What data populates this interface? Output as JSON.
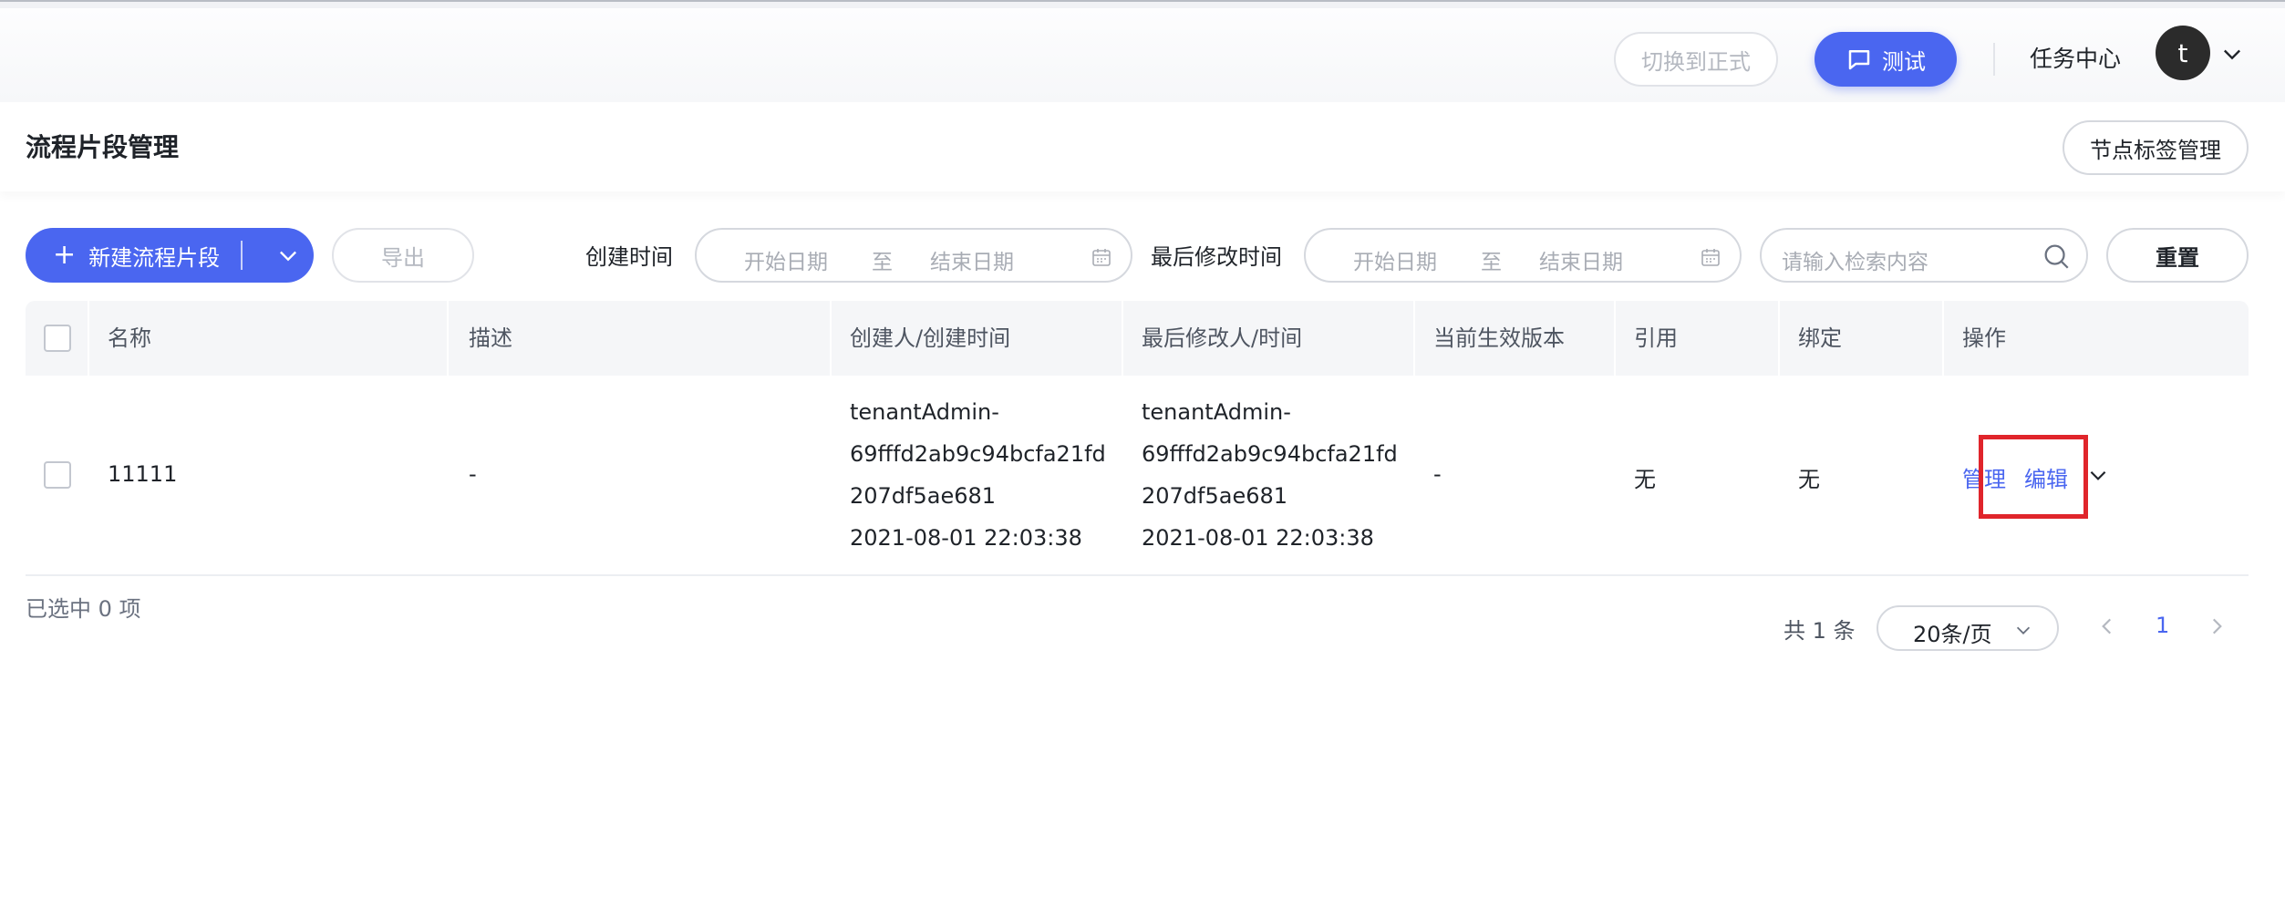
{
  "header": {
    "switch_formal_label": "切换到正式",
    "test_label": "测试",
    "task_center_label": "任务中心",
    "avatar_initial": "t"
  },
  "page": {
    "title": "流程片段管理",
    "tag_manage_label": "节点标签管理"
  },
  "toolbar": {
    "new_label": "新建流程片段",
    "export_label": "导出",
    "create_time_label": "创建时间",
    "modify_time_label": "最后修改时间",
    "start_placeholder": "开始日期",
    "to_label": "至",
    "end_placeholder": "结束日期",
    "search_placeholder": "请输入检索内容",
    "reset_label": "重置"
  },
  "table": {
    "columns": [
      "名称",
      "描述",
      "创建人/创建时间",
      "最后修改人/时间",
      "当前生效版本",
      "引用",
      "绑定",
      "操作"
    ],
    "rows": [
      {
        "name": "11111",
        "description": "-",
        "creator_line1": "tenantAdmin-",
        "creator_line2": "69fffd2ab9c94bcfa21fd",
        "creator_line3": "207df5ae681",
        "create_time": "2021-08-01 22:03:38",
        "modifier_line1": "tenantAdmin-",
        "modifier_line2": "69fffd2ab9c94bcfa21fd",
        "modifier_line3": "207df5ae681",
        "modify_time": "2021-08-01 22:03:38",
        "version": "-",
        "reference": "无",
        "binding": "无",
        "op_manage": "管理",
        "op_edit": "编辑"
      }
    ]
  },
  "footer": {
    "selected_text": "已选中 0 项",
    "total_text": "共 1 条",
    "page_size": "20条/页",
    "current_page": "1"
  },
  "colors": {
    "primary": "#4a66f0",
    "highlight": "#e0252b"
  }
}
